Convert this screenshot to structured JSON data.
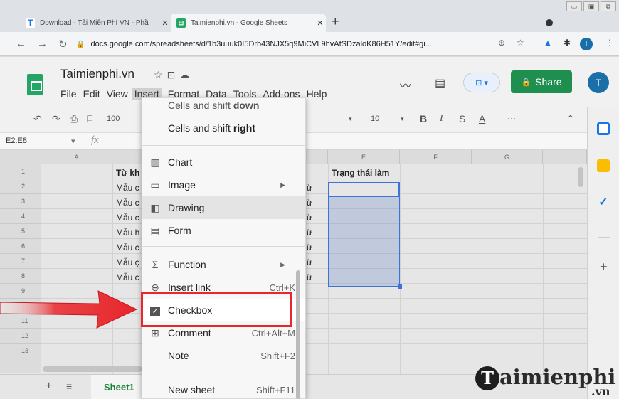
{
  "browser": {
    "tabs": [
      {
        "title": "Download - Tải Miễn Phí VN - Phầ",
        "favicon": "T",
        "favicon_color": "#1a73e8",
        "active": false
      },
      {
        "title": "Taimienphi.vn - Google Sheets",
        "favicon": "⊞",
        "favicon_color": "#23a566",
        "active": true
      }
    ],
    "url": "docs.google.com/spreadsheets/d/1b3uuuk0I5Drb43NJX5q9MiCVL9hvAfSDzaloK86H51Y/edit#gi...",
    "avatar_letter": "T"
  },
  "sheets": {
    "doc_title": "Taimienphi.vn",
    "menus": [
      "File",
      "Edit",
      "View",
      "Insert",
      "Format",
      "Data",
      "Tools",
      "Add-ons",
      "Help"
    ],
    "open_menu": "Insert",
    "share_label": "Share",
    "avatar_letter": "T",
    "brand_color": "#23a566"
  },
  "toolbar": {
    "zoom": "100",
    "font_size": "10",
    "more": "···"
  },
  "formula_bar": {
    "name_box": "E2:E8",
    "fx": "fx"
  },
  "grid": {
    "columns": [
      "A",
      "E",
      "F",
      "G"
    ],
    "rows": [
      "1",
      "2",
      "3",
      "4",
      "5",
      "6",
      "7",
      "8",
      "9",
      "11",
      "12",
      "13"
    ],
    "b_values": [
      "Từ kh",
      "Mẫu c",
      "Mẫu c",
      "Mẫu c",
      "Mẫu h",
      "Mẫu c",
      "Mẫu ç",
      "Mẫu c"
    ],
    "d_fragments": [
      "ừ",
      "ừ",
      "ừ",
      "ừ",
      "ừ",
      "ừ",
      "ừ"
    ],
    "e1": "Trạng thái làm"
  },
  "insert_menu": {
    "items": [
      {
        "label": "Cells and shift down",
        "icon": "",
        "shortcut": "",
        "submenu": false
      },
      {
        "label": "Cells and shift right",
        "icon": "",
        "shortcut": "",
        "submenu": false
      },
      {
        "label": "Chart",
        "icon": "chart-icon",
        "shortcut": "",
        "submenu": false
      },
      {
        "label": "Image",
        "icon": "image-icon",
        "shortcut": "",
        "submenu": true
      },
      {
        "label": "Drawing",
        "icon": "drawing-icon",
        "shortcut": "",
        "submenu": false
      },
      {
        "label": "Form",
        "icon": "form-icon",
        "shortcut": "",
        "submenu": false
      },
      {
        "label": "Function",
        "icon": "sigma-icon",
        "shortcut": "",
        "submenu": true
      },
      {
        "label": "Insert link",
        "icon": "link-icon",
        "shortcut": "Ctrl+K",
        "submenu": false
      },
      {
        "label": "Checkbox",
        "icon": "checkbox-icon",
        "shortcut": "",
        "submenu": false
      },
      {
        "label": "Comment",
        "icon": "comment-icon",
        "shortcut": "Ctrl+Alt+M",
        "submenu": false
      },
      {
        "label": "Note",
        "icon": "",
        "shortcut": "Shift+F2",
        "submenu": false
      },
      {
        "label": "New sheet",
        "icon": "",
        "shortcut": "Shift+F11",
        "submenu": false
      }
    ],
    "highlighted": "Drawing",
    "annotated": "Checkbox"
  },
  "sheet_tabs": {
    "active": "Sheet1"
  },
  "watermark": {
    "text": "aimienphi",
    "suffix": ".vn"
  },
  "colors": {
    "highlight_border": "#e8262b",
    "selection": "#3b73d8",
    "share_green": "#1f8f4f"
  }
}
